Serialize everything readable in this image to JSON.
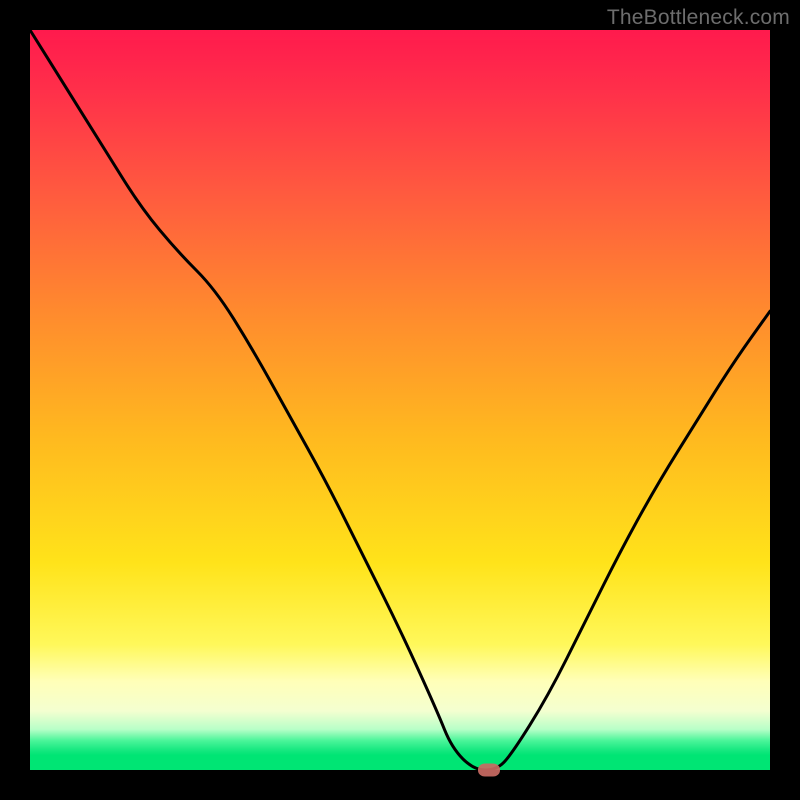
{
  "watermark": "TheBottleneck.com",
  "colors": {
    "frame": "#000000",
    "curve": "#000000",
    "marker": "#c96a63",
    "gradient_top": "#ff1a4d",
    "gradient_bottom": "#00e574"
  },
  "chart_data": {
    "type": "line",
    "title": "",
    "xlabel": "",
    "ylabel": "",
    "xlim": [
      0,
      100
    ],
    "ylim": [
      0,
      100
    ],
    "x": [
      0,
      5,
      10,
      15,
      20,
      25,
      30,
      35,
      40,
      45,
      50,
      55,
      57,
      60,
      63,
      65,
      70,
      75,
      80,
      85,
      90,
      95,
      100
    ],
    "values": [
      100,
      92,
      84,
      76,
      70,
      65,
      57,
      48,
      39,
      29,
      19,
      8,
      3,
      0,
      0,
      2,
      10,
      20,
      30,
      39,
      47,
      55,
      62
    ],
    "marker": {
      "x": 62,
      "y": 0
    },
    "notes": "V-shaped bottleneck curve; left branch steeper with slight knee near x≈20; minimum flattens around x≈58–64; right branch rises roughly linearly. Axes unlabeled; gradient background encodes vertical position (red=high bottleneck, green=low)."
  }
}
